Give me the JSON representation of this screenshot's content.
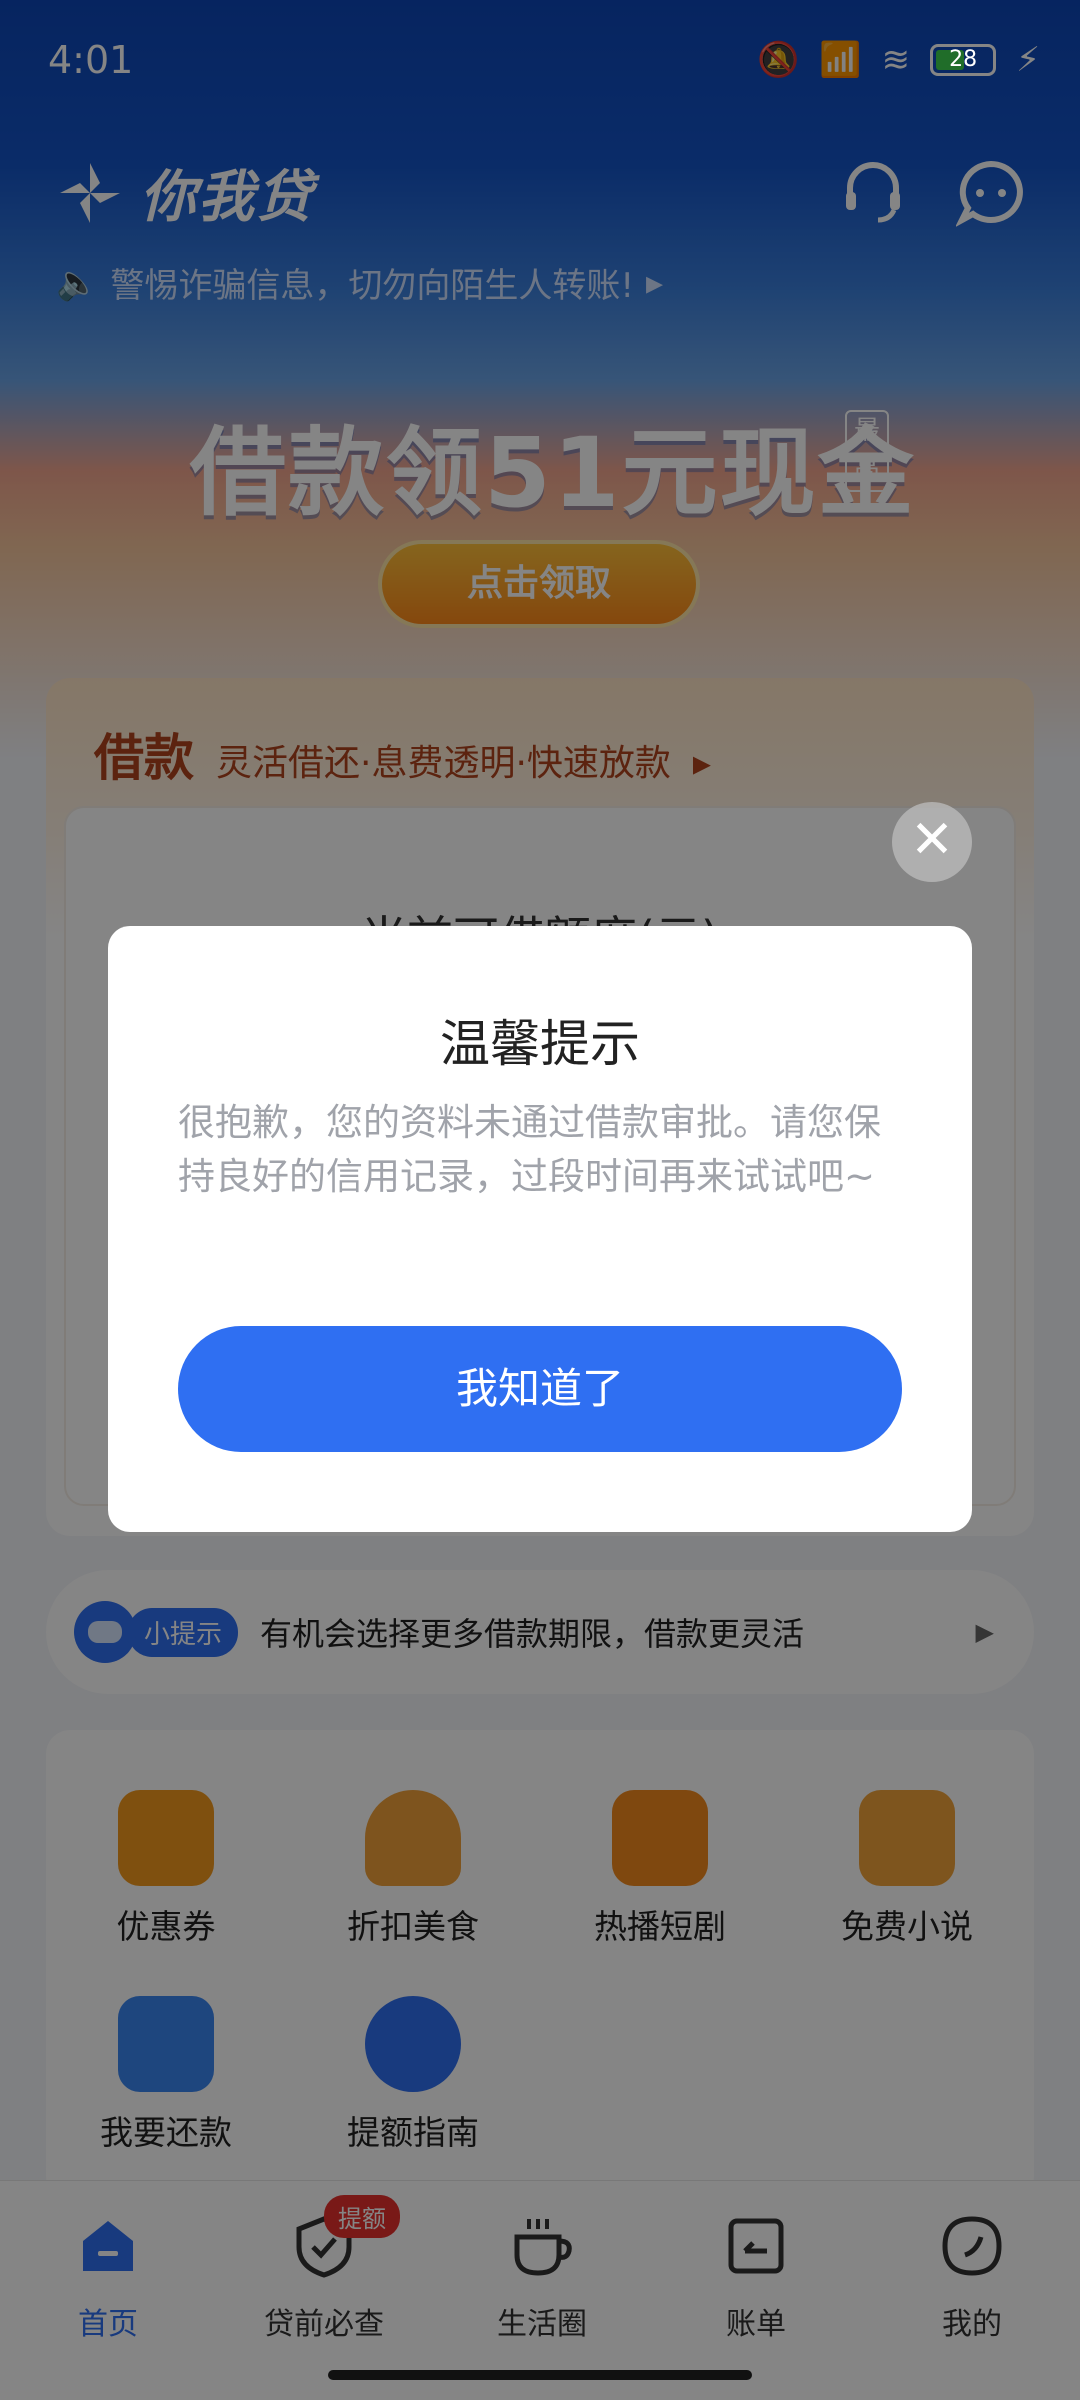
{
  "status_bar": {
    "time": "4:01",
    "battery": "28"
  },
  "header": {
    "brand_name": "你我贷",
    "notice": "警惕诈骗信息，切勿向陌生人转账!",
    "promo_title": "借款领51元现金",
    "promo_tag": "最高",
    "promo_button": "点击领取"
  },
  "loan_card": {
    "title": "借款",
    "subtitle": "灵活借还·息费透明·快速放款",
    "limit_label": "当前可借额度(元)"
  },
  "tip_bar": {
    "badge": "小提示",
    "text": "有机会选择更多借款期限，借款更灵活"
  },
  "grid": {
    "items": [
      {
        "label": "优惠券",
        "icon": "coupon-icon",
        "color": "#f39a1e"
      },
      {
        "label": "折扣美食",
        "icon": "burger-icon",
        "color": "#f2a13a"
      },
      {
        "label": "热播短剧",
        "icon": "video-play-icon",
        "color": "#f38a1e"
      },
      {
        "label": "免费小说",
        "icon": "book-icon",
        "color": "#f2a33a"
      },
      {
        "label": "我要还款",
        "icon": "yuan-repay-icon",
        "color": "#3a86f2"
      },
      {
        "label": "提额指南",
        "icon": "trend-up-icon",
        "color": "#2f6ff2"
      }
    ]
  },
  "tabs": {
    "items": [
      {
        "label": "首页",
        "icon": "home-icon",
        "active": true
      },
      {
        "label": "贷前必查",
        "icon": "shield-check-icon",
        "badge": "提额"
      },
      {
        "label": "生活圈",
        "icon": "cup-icon"
      },
      {
        "label": "账单",
        "icon": "bill-icon"
      },
      {
        "label": "我的",
        "icon": "profile-leaf-icon"
      }
    ]
  },
  "dialog": {
    "title": "温馨提示",
    "message": "很抱歉，您的资料未通过借款审批。请您保持良好的信用记录，过段时间再来试试吧~",
    "confirm_button": "我知道了",
    "close_symbol": "✕"
  },
  "colors": {
    "brand_blue": "#2f6ff2",
    "loan_accent": "#b0431d",
    "badge_red": "#e8312d"
  }
}
